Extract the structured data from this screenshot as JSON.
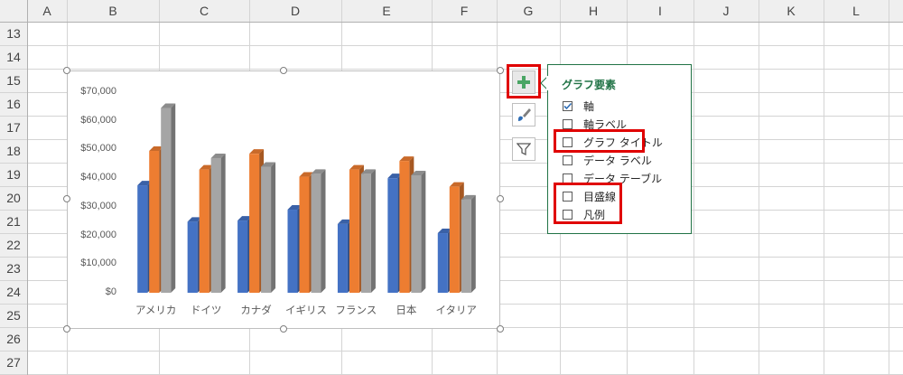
{
  "sheet": {
    "columns": [
      "A",
      "B",
      "C",
      "D",
      "E",
      "F",
      "G",
      "H",
      "I",
      "J",
      "K",
      "L"
    ],
    "rows": [
      "13",
      "14",
      "15",
      "16",
      "17",
      "18",
      "19",
      "20",
      "21",
      "22",
      "23",
      "24",
      "25",
      "26",
      "27"
    ]
  },
  "chart_data": {
    "type": "bar",
    "categories": [
      "アメリカ",
      "ドイツ",
      "カナダ",
      "イギリス",
      "フランス",
      "日本",
      "イタリア"
    ],
    "series": [
      {
        "values": [
          37500,
          24800,
          25200,
          29000,
          24000,
          40000,
          20800
        ],
        "color": "#4472c4"
      },
      {
        "values": [
          49500,
          43000,
          48500,
          40500,
          43000,
          46000,
          37000
        ],
        "color": "#ed7d31"
      },
      {
        "values": [
          64500,
          47000,
          44000,
          41500,
          41500,
          41000,
          32500
        ],
        "color": "#a5a5a5"
      }
    ],
    "yticks": [
      "$70,000",
      "$60,000",
      "$50,000",
      "$40,000",
      "$30,000",
      "$20,000",
      "$10,000",
      "$0"
    ],
    "ylim": [
      0,
      70000
    ],
    "style": "3d-clustered-column"
  },
  "side_buttons": {
    "elements_icon": "plus-icon",
    "styles_icon": "brush-icon",
    "filter_icon": "funnel-icon"
  },
  "panel": {
    "title": "グラフ要素",
    "items": [
      {
        "label": "軸",
        "checked": true
      },
      {
        "label": "軸ラベル",
        "checked": false
      },
      {
        "label": "グラフ タイトル",
        "checked": false
      },
      {
        "label": "データ ラベル",
        "checked": false
      },
      {
        "label": "データ テーブル",
        "checked": false
      },
      {
        "label": "目盛線",
        "checked": false
      },
      {
        "label": "凡例",
        "checked": false
      }
    ]
  },
  "colors": {
    "accent_green": "#217346",
    "highlight_red": "#e00000"
  }
}
